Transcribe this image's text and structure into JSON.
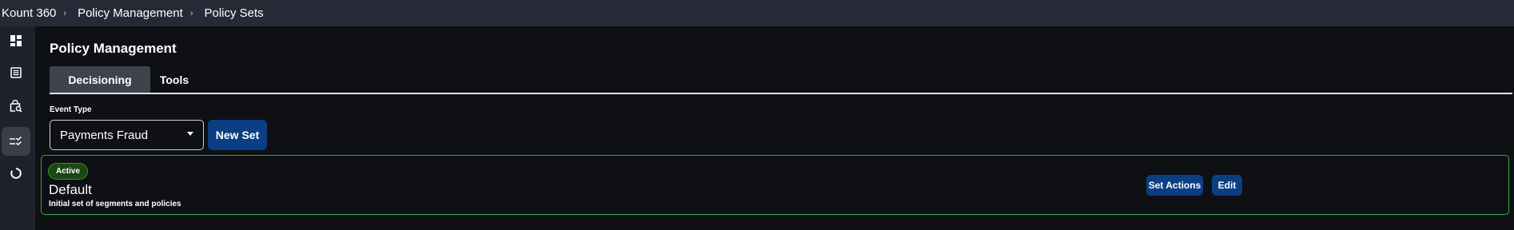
{
  "breadcrumb": [
    "Kount 360",
    "Policy Management",
    "Policy Sets"
  ],
  "sidebar": {
    "items": [
      {
        "icon": "dashboard-icon",
        "active": false
      },
      {
        "icon": "list-icon",
        "active": false
      },
      {
        "icon": "bag-search-icon",
        "active": false
      },
      {
        "icon": "policy-checklist-icon",
        "active": true
      },
      {
        "icon": "ring-icon",
        "active": false
      }
    ]
  },
  "page": {
    "title": "Policy Management",
    "tabs": [
      {
        "label": "Decisioning",
        "active": true
      },
      {
        "label": "Tools",
        "active": false
      }
    ]
  },
  "event_type": {
    "label": "Event Type",
    "selected": "Payments Fraud"
  },
  "actions": {
    "new_set": "New Set"
  },
  "policy_set": {
    "status": "Active",
    "name": "Default",
    "description": "Initial set of segments and policies",
    "set_actions": "Set Actions",
    "edit": "Edit"
  },
  "colors": {
    "background": "#0e1013",
    "topbar": "#252a36",
    "sidebar": "#1e222b",
    "primary_button": "#0a3f85",
    "active_border": "#2fae3f",
    "active_badge": "#1c4712"
  }
}
